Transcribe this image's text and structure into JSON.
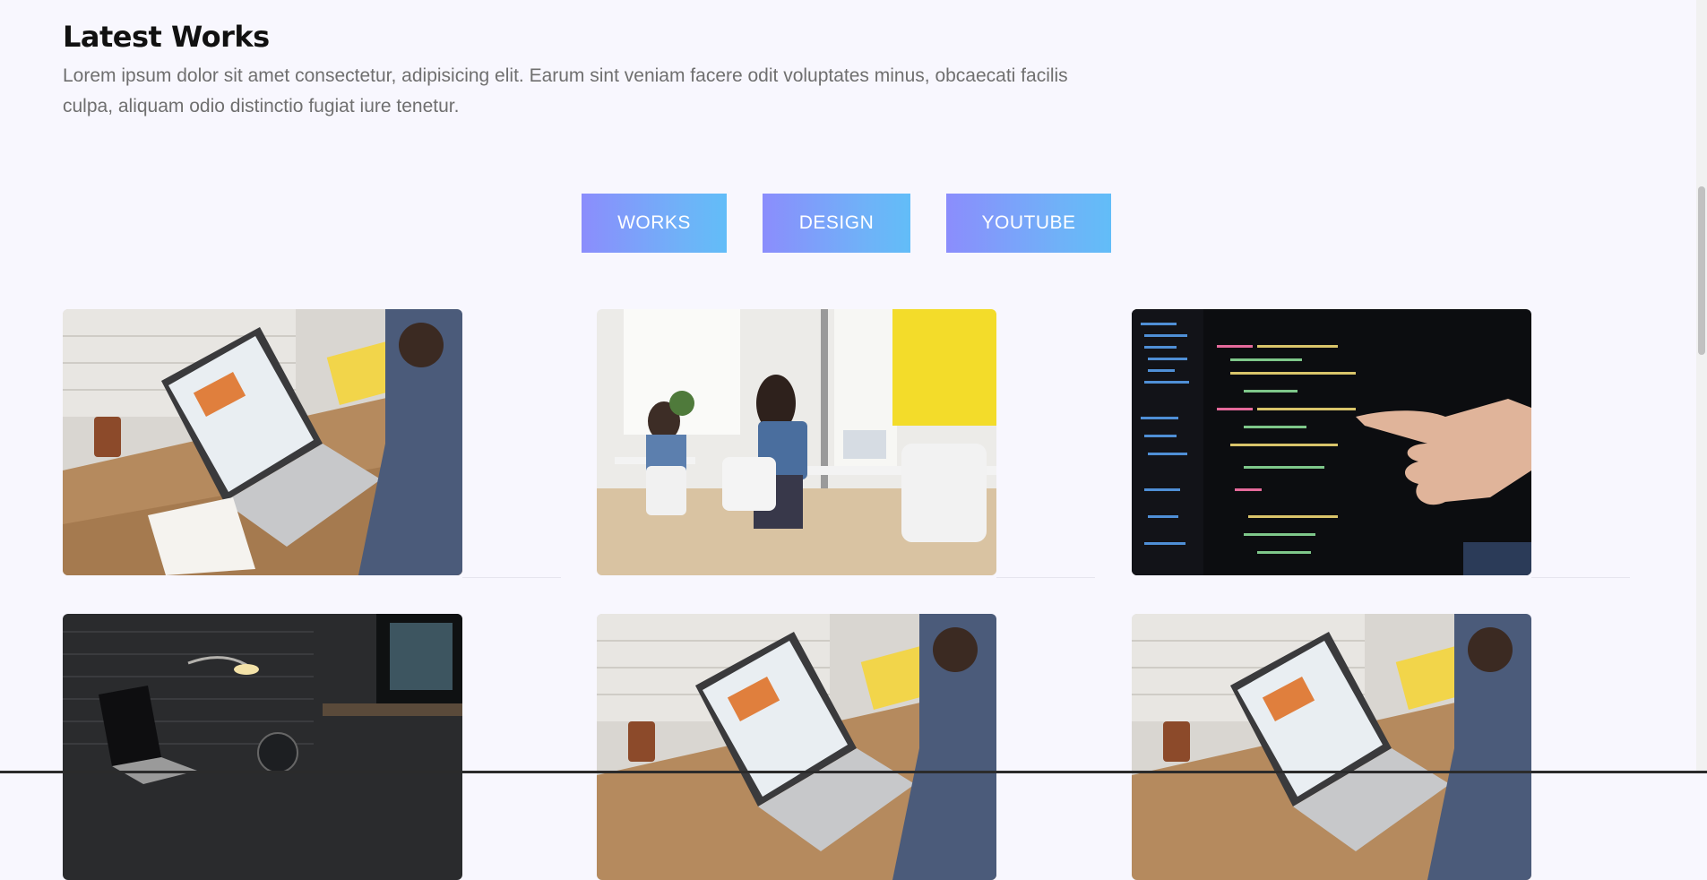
{
  "section": {
    "title": "Latest Works",
    "description": "Lorem ipsum dolor sit amet consectetur, adipisicing elit. Earum sint veniam facere odit voluptates minus, obcaecati facilis culpa, aliquam odio distinctio fugiat iure tenetur."
  },
  "filters": [
    {
      "label": "WORKS"
    },
    {
      "label": "DESIGN"
    },
    {
      "label": "YOUTUBE"
    }
  ],
  "colors": {
    "button_gradient_start": "#8b8dfc",
    "button_gradient_end": "#62bdf8",
    "background": "#f8f7fe"
  },
  "works": [
    {
      "image": "laptop-desk-photo"
    },
    {
      "image": "office-women-photo"
    },
    {
      "image": "code-screen-photo"
    },
    {
      "image": "dark-laptop-photo"
    },
    {
      "image": "laptop-desk-photo"
    },
    {
      "image": "laptop-desk-photo"
    }
  ]
}
